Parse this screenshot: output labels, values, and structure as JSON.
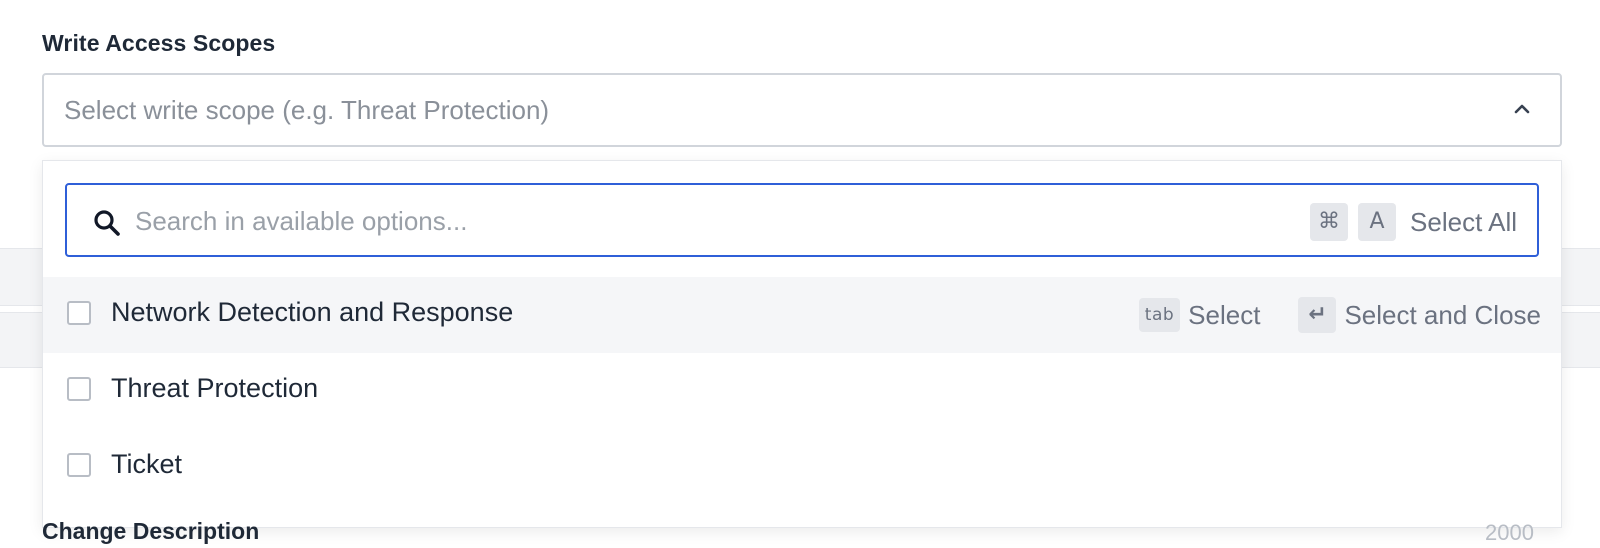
{
  "form": {
    "write_scopes_label": "Write Access Scopes",
    "select_placeholder": "Select write scope (e.g. Threat Protection)",
    "change_description_label": "Change Description",
    "change_description_counter": "2000"
  },
  "dropdown": {
    "search_placeholder": "Search in available options...",
    "select_all": {
      "key_cmd": "⌘",
      "key_a": "A",
      "label": "Select All"
    },
    "options": [
      {
        "label": "Network Detection and Response",
        "checked": false,
        "highlighted": true
      },
      {
        "label": "Threat Protection",
        "checked": false,
        "highlighted": false
      },
      {
        "label": "Ticket",
        "checked": false,
        "highlighted": false
      }
    ],
    "hints": {
      "tab_key": "tab",
      "tab_label": "Select",
      "enter_key": "↵",
      "enter_label": "Select and Close"
    }
  },
  "icons": {
    "search": "search-icon",
    "chevron": "chevron-up-icon"
  },
  "colors": {
    "focus_border": "#2f5fd8",
    "text_primary": "#1f2937",
    "text_muted": "#6b7280",
    "highlight_bg": "#f5f6f8"
  }
}
